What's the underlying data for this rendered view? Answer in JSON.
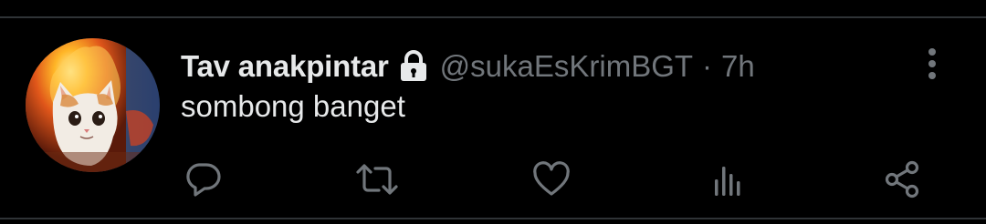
{
  "tweet": {
    "display_name": "Tav anakpintar",
    "handle": "@sukaEsKrimBGT",
    "separator": "·",
    "time": "7h",
    "text": "sombong banget"
  },
  "icons": {
    "lock": "lock-icon",
    "more": "more-vertical-icon",
    "reply": "reply-icon",
    "retweet": "retweet-icon",
    "like": "heart-icon",
    "analytics": "analytics-icon",
    "share": "share-icon"
  },
  "colors": {
    "background": "#000000",
    "primary_text": "#e7e9ea",
    "secondary_text": "#71767b",
    "divider": "#2f3336"
  }
}
